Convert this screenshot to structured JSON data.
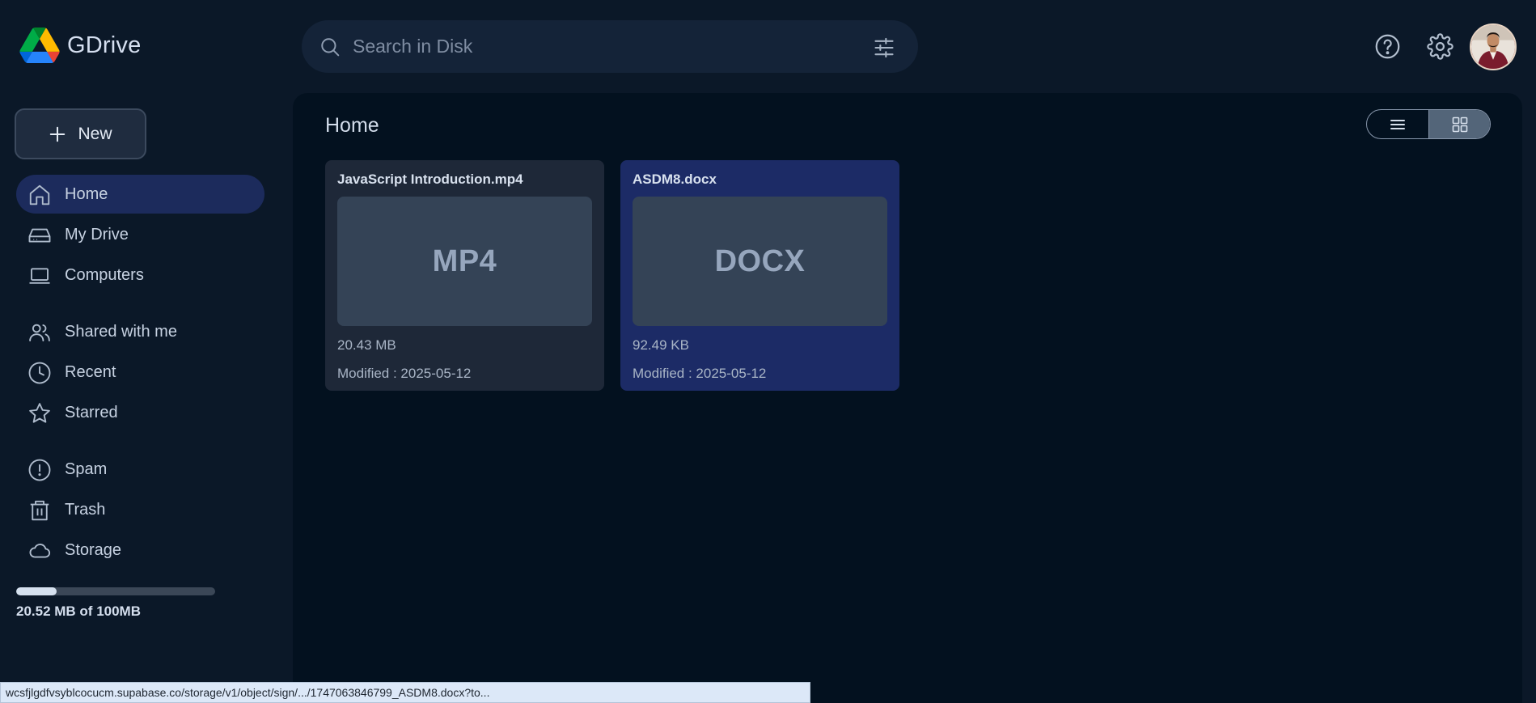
{
  "brand": {
    "name": "GDrive"
  },
  "search": {
    "placeholder": "Search in Disk",
    "value": ""
  },
  "header": {
    "icons": [
      "help-icon",
      "settings-icon",
      "avatar"
    ]
  },
  "sidebar": {
    "new_label": "New",
    "items": [
      {
        "label": "Home",
        "icon": "home-icon",
        "active": true
      },
      {
        "label": "My Drive",
        "icon": "drive-icon",
        "active": false
      },
      {
        "label": "Computers",
        "icon": "laptop-icon",
        "active": false
      },
      {
        "label": "Shared with me",
        "icon": "users-icon",
        "active": false
      },
      {
        "label": "Recent",
        "icon": "clock-icon",
        "active": false
      },
      {
        "label": "Starred",
        "icon": "star-icon",
        "active": false
      },
      {
        "label": "Spam",
        "icon": "alert-icon",
        "active": false
      },
      {
        "label": "Trash",
        "icon": "trash-icon",
        "active": false
      },
      {
        "label": "Storage",
        "icon": "cloud-icon",
        "active": false
      }
    ],
    "storage": {
      "used_text": "20.52 MB of 100MB",
      "used_fraction": 0.2052
    }
  },
  "main": {
    "title": "Home",
    "view_mode": "grid",
    "files": [
      {
        "name": "JavaScript Introduction.mp4",
        "ext": "MP4",
        "size": "20.43 MB",
        "modified": "Modified : 2025-05-12",
        "selected": false
      },
      {
        "name": "ASDM8.docx",
        "ext": "DOCX",
        "size": "92.49 KB",
        "modified": "Modified : 2025-05-12",
        "selected": true
      }
    ]
  },
  "status": {
    "url": "wcsfjlgdfvsyblcocucm.supabase.co/storage/v1/object/sign/.../1747063846799_ASDM8.docx?to..."
  },
  "colors": {
    "background": "#0b1828",
    "main_panel": "#03111f",
    "active_nav": "#1c2b5c",
    "selected_card": "#1c2b66",
    "card": "#1e2838"
  }
}
